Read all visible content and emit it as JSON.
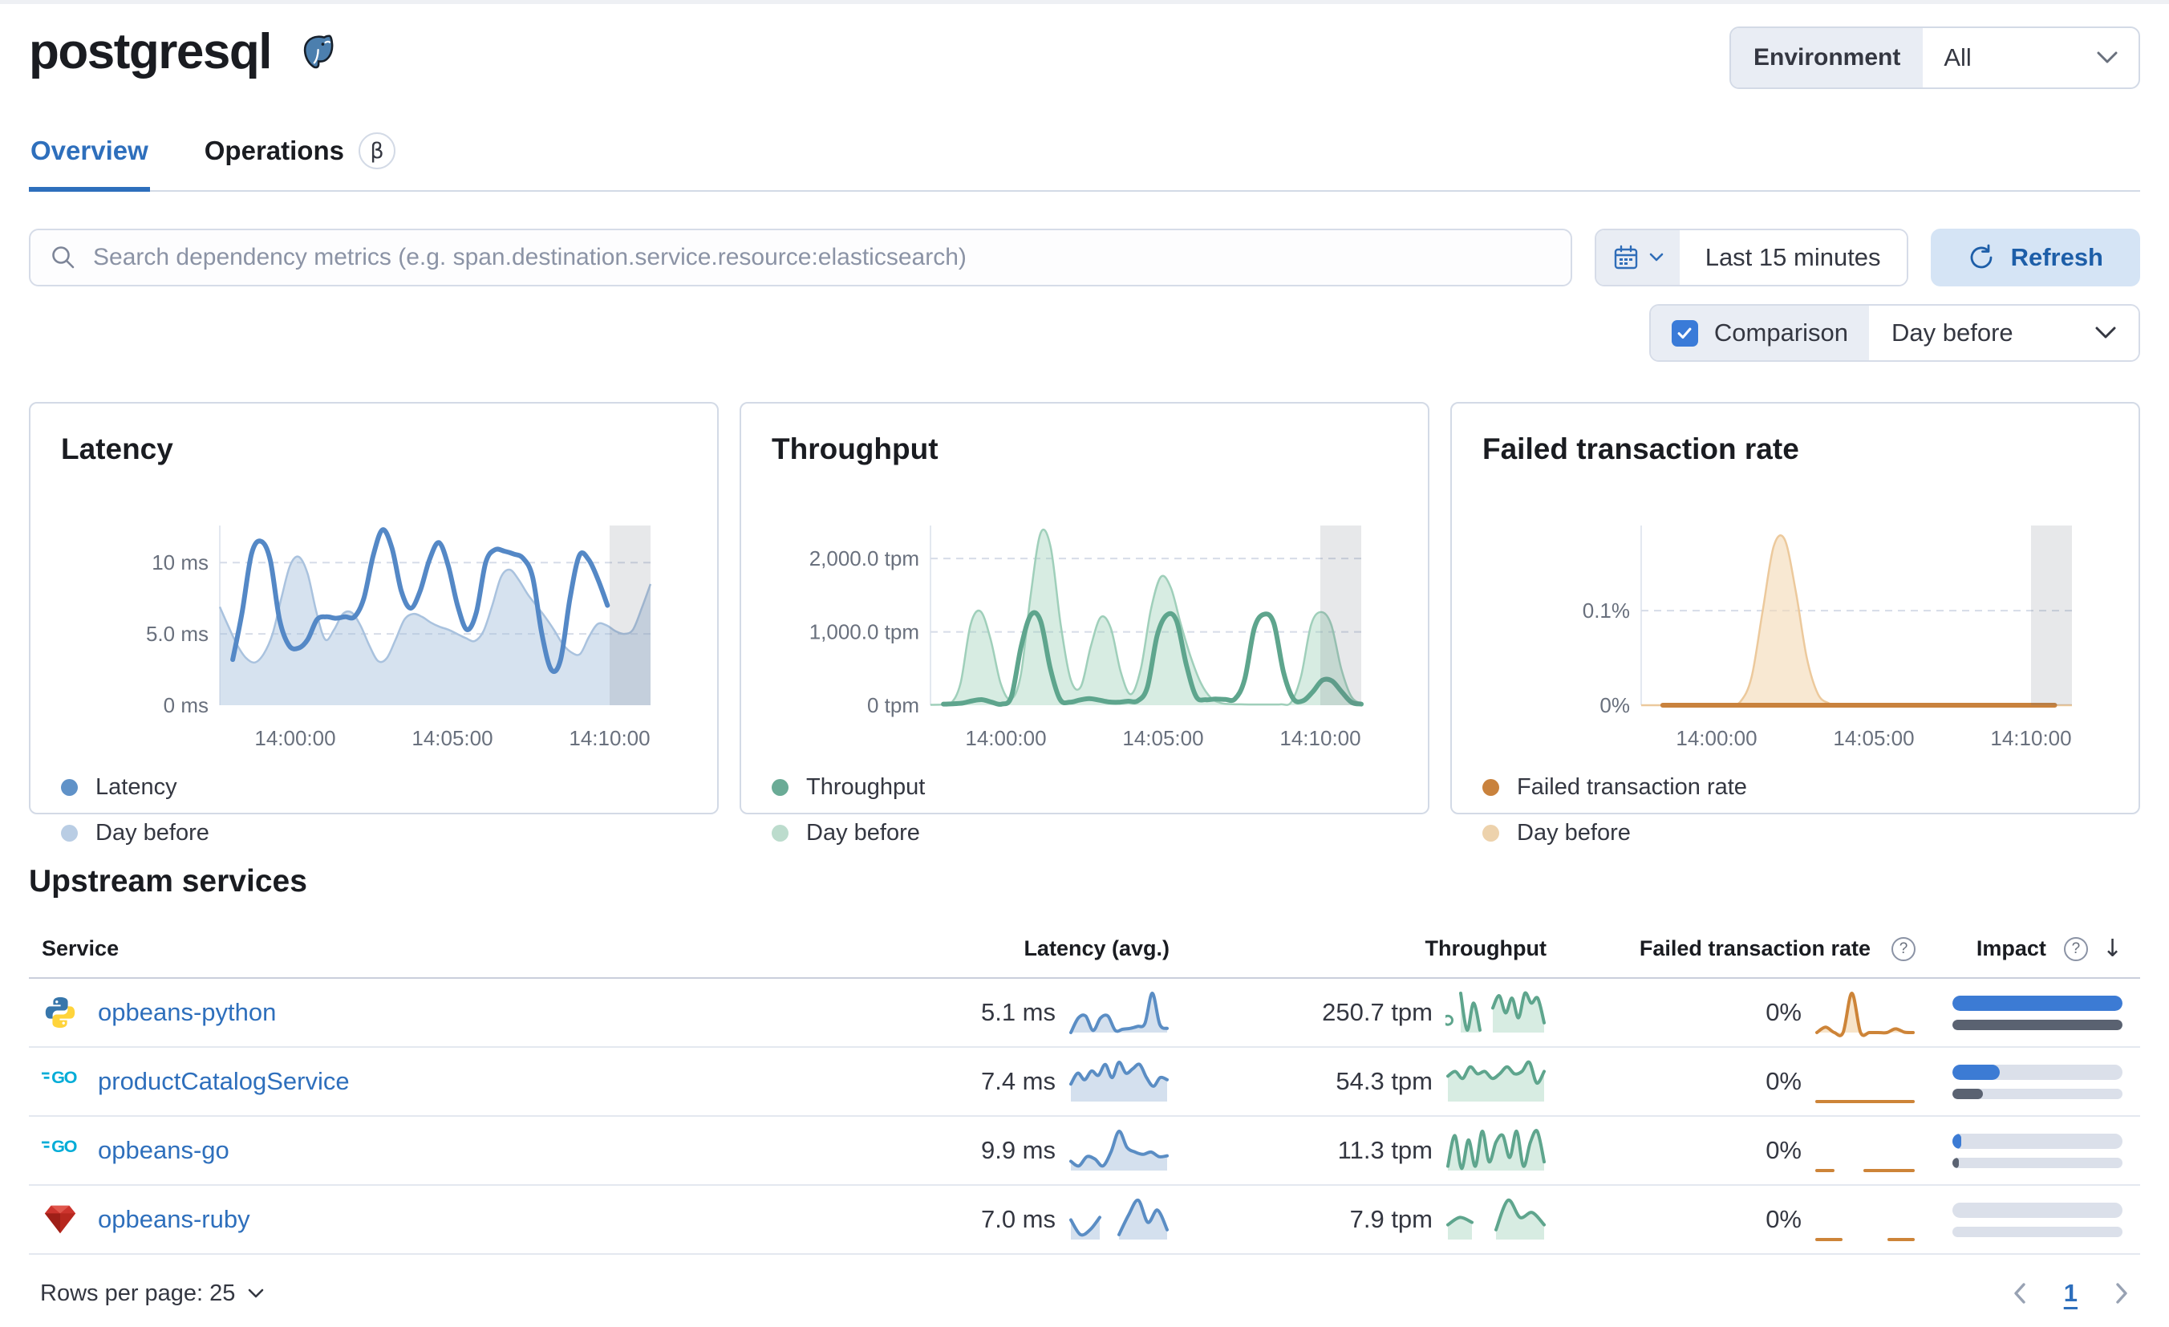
{
  "header": {
    "title": "postgresql",
    "environment_label": "Environment",
    "environment_value": "All"
  },
  "tabs": {
    "overview": "Overview",
    "operations": "Operations",
    "beta": "β"
  },
  "toolbar": {
    "search_placeholder": "Search dependency metrics (e.g. span.destination.service.resource:elasticsearch)",
    "time_range": "Last 15 minutes",
    "refresh_label": "Refresh",
    "comparison_label": "Comparison",
    "comparison_value": "Day before"
  },
  "chart_data": [
    {
      "type": "line",
      "title": "Latency",
      "ylim": [
        0,
        12.6
      ],
      "yticks": [
        {
          "value": 10,
          "label": "10 ms"
        },
        {
          "value": 5,
          "label": "5.0 ms"
        },
        {
          "value": 0,
          "label": "0 ms"
        }
      ],
      "xticks": [
        {
          "frac": 0.175,
          "label": "14:00:00"
        },
        {
          "frac": 0.54,
          "label": "14:05:00"
        },
        {
          "frac": 0.905,
          "label": "14:10:00"
        }
      ],
      "partial_band": [
        0.905,
        1.0
      ],
      "legend": [
        {
          "label": "Latency",
          "color": "#6092c8"
        },
        {
          "label": "Day before",
          "color": "#b9cde4"
        }
      ],
      "series": [
        {
          "name": "Day before",
          "kind": "area",
          "color": "#a9c2de",
          "fill": "rgba(164,190,219,0.45)",
          "x_start": 0,
          "x_end": 1,
          "values": [
            6.9,
            5.5,
            4.2,
            3.3,
            3.0,
            3.6,
            5.0,
            7.5,
            9.8,
            10.4,
            9.2,
            6.5,
            4.6,
            5.3,
            6.4,
            6.5,
            5.6,
            4.2,
            3.1,
            3.3,
            4.6,
            6.0,
            6.4,
            6.2,
            5.8,
            5.5,
            5.3,
            5.0,
            4.7,
            4.5,
            5.2,
            7.0,
            9.0,
            9.5,
            8.8,
            7.8,
            7.0,
            6.2,
            5.3,
            4.3,
            3.7,
            3.6,
            4.8,
            5.7,
            5.6,
            5.2,
            5.0,
            5.3,
            6.8,
            8.5
          ]
        },
        {
          "name": "Latency",
          "kind": "line",
          "color": "#5488c6",
          "x_start": 0.03,
          "x_end": 0.9,
          "values": [
            3.2,
            6.5,
            10.6,
            11.5,
            10.2,
            6.0,
            4.2,
            4.0,
            4.6,
            6.0,
            6.2,
            6.1,
            6.2,
            6.2,
            7.5,
            10.5,
            12.3,
            11.0,
            8.0,
            6.8,
            8.0,
            10.2,
            11.4,
            9.8,
            7.0,
            5.3,
            6.5,
            10.0,
            10.9,
            10.8,
            10.6,
            10.3,
            9.0,
            5.0,
            2.5,
            3.2,
            7.5,
            10.5,
            10.2,
            8.8,
            7.0
          ]
        }
      ]
    },
    {
      "type": "line",
      "title": "Throughput",
      "ylim": [
        0,
        2450
      ],
      "yticks": [
        {
          "value": 2000,
          "label": "2,000.0 tpm"
        },
        {
          "value": 1000,
          "label": "1,000.0 tpm"
        },
        {
          "value": 0,
          "label": "0 tpm"
        }
      ],
      "xticks": [
        {
          "frac": 0.175,
          "label": "14:00:00"
        },
        {
          "frac": 0.54,
          "label": "14:05:00"
        },
        {
          "frac": 0.905,
          "label": "14:10:00"
        }
      ],
      "partial_band": [
        0.905,
        1.0
      ],
      "legend": [
        {
          "label": "Throughput",
          "color": "#6aab96"
        },
        {
          "label": "Day before",
          "color": "#bcdccd"
        }
      ],
      "series": [
        {
          "name": "Day before",
          "kind": "area",
          "color": "#9fcfba",
          "fill": "rgba(150,205,180,0.38)",
          "x_start": 0,
          "x_end": 1,
          "values": [
            5,
            8,
            20,
            300,
            1100,
            1280,
            900,
            300,
            80,
            400,
            1500,
            2350,
            2150,
            1100,
            350,
            250,
            800,
            1200,
            1050,
            450,
            150,
            500,
            1300,
            1750,
            1600,
            1100,
            650,
            300,
            100,
            30,
            15,
            12,
            10,
            10,
            10,
            12,
            40,
            400,
            1100,
            1270,
            1100,
            500,
            120,
            20
          ]
        },
        {
          "name": "Throughput",
          "kind": "line",
          "color": "#5ea58d",
          "x_start": 0.03,
          "x_end": 1,
          "values": [
            15,
            20,
            30,
            60,
            75,
            40,
            15,
            120,
            800,
            1230,
            1150,
            500,
            80,
            40,
            70,
            90,
            70,
            45,
            40,
            55,
            60,
            250,
            950,
            1230,
            1150,
            550,
            120,
            75,
            85,
            80,
            85,
            350,
            1050,
            1240,
            1120,
            450,
            90,
            60,
            180,
            340,
            330,
            180,
            40,
            15
          ]
        }
      ]
    },
    {
      "type": "line",
      "title": "Failed transaction rate",
      "ylim": [
        0,
        0.19
      ],
      "yticks": [
        {
          "value": 0.1,
          "label": "0.1%"
        },
        {
          "value": 0,
          "label": "0%"
        }
      ],
      "xticks": [
        {
          "frac": 0.175,
          "label": "14:00:00"
        },
        {
          "frac": 0.54,
          "label": "14:05:00"
        },
        {
          "frac": 0.905,
          "label": "14:10:00"
        }
      ],
      "partial_band": [
        0.905,
        1.0
      ],
      "legend": [
        {
          "label": "Failed transaction rate",
          "color": "#c9823d"
        },
        {
          "label": "Day before",
          "color": "#edd2ac"
        }
      ],
      "series": [
        {
          "name": "Day before",
          "kind": "area",
          "color": "#ecc99c",
          "fill": "rgba(243,216,180,0.6)",
          "x_start": 0,
          "x_end": 1,
          "values": [
            0,
            0,
            0,
            0,
            0,
            0,
            0,
            0,
            0,
            0.004,
            0.03,
            0.1,
            0.168,
            0.175,
            0.12,
            0.05,
            0.012,
            0.002,
            0,
            0,
            0,
            0,
            0,
            0,
            0,
            0,
            0,
            0,
            0,
            0,
            0,
            0,
            0,
            0,
            0,
            0,
            0,
            0,
            0,
            0
          ]
        },
        {
          "name": "Failed transaction rate",
          "kind": "line",
          "color": "#c9823d",
          "x_start": 0.05,
          "x_end": 0.96,
          "values": [
            0,
            0,
            0,
            0,
            0,
            0,
            0,
            0,
            0,
            0,
            0,
            0,
            0
          ]
        }
      ]
    }
  ],
  "table": {
    "section_title": "Upstream services",
    "columns": {
      "service": "Service",
      "latency": "Latency (avg.)",
      "throughput": "Throughput",
      "failed": "Failed transaction rate",
      "impact": "Impact"
    },
    "rows": [
      {
        "name": "opbeans-python",
        "icon": "python-icon",
        "latency": "5.1 ms",
        "throughput": "250.7 tpm",
        "failed": "0%",
        "impact": {
          "current": 100,
          "previous": 100
        },
        "sparks": {
          "latency": {
            "color": "#5a8dc4",
            "fill": "rgba(160,187,217,0.45)",
            "values": [
              0,
              3.5,
              4,
              0.5,
              3.5,
              4,
              0.5,
              0.8,
              1,
              1.5,
              2.2,
              9.5,
              2,
              1
            ]
          },
          "throughput": {
            "color": "#5ea58d",
            "fill": "rgba(150,205,180,0.38)",
            "marker": [
              0,
              2.5
            ],
            "values": [
              null,
              null,
              8,
              0.5,
              6,
              0.5,
              null,
              5,
              7.5,
              4,
              7,
              3,
              8,
              6,
              7,
              2
            ]
          },
          "failed": {
            "color": "#cd8438",
            "fill": "rgba(243,216,180,0.7)",
            "values": [
              0,
              1.3,
              0,
              0,
              9.5,
              0,
              0,
              0,
              0,
              0.9,
              0.1,
              0
            ]
          }
        }
      },
      {
        "name": "productCatalogService",
        "icon": "go-icon",
        "latency": "7.4 ms",
        "throughput": "54.3 tpm",
        "failed": "0%",
        "impact": {
          "current": 28,
          "previous": 18
        },
        "sparks": {
          "latency": {
            "color": "#5a8dc4",
            "fill": "rgba(160,187,217,0.45)",
            "values": [
              4,
              6.5,
              5,
              7,
              6,
              8.5,
              5.5,
              9,
              6.5,
              7.5,
              8.5,
              5.5,
              3.5,
              5.5,
              5
            ]
          },
          "throughput": {
            "color": "#5ea58d",
            "fill": "rgba(150,205,180,0.38)",
            "values": [
              5.5,
              6.5,
              5,
              7.5,
              6,
              6.5,
              5,
              6,
              7.5,
              6,
              6.5,
              8.5,
              4,
              6.5
            ]
          },
          "failed": {
            "color": "#cd8438",
            "fill": "none",
            "values": [
              0,
              0,
              0,
              0,
              0,
              0,
              0,
              0
            ]
          }
        }
      },
      {
        "name": "opbeans-go",
        "icon": "go-icon",
        "latency": "9.9 ms",
        "throughput": "11.3 tpm",
        "failed": "0%",
        "impact": {
          "current": 5,
          "previous": 4
        },
        "sparks": {
          "latency": {
            "color": "#5a8dc4",
            "fill": "rgba(160,187,217,0.45)",
            "values": [
              2,
              1,
              3,
              2.5,
              1,
              4,
              8.5,
              5,
              4,
              3.5,
              4,
              3,
              3.2
            ]
          },
          "throughput": {
            "color": "#5ea58d",
            "fill": "rgba(150,205,180,0.38)",
            "values": [
              1,
              8,
              0.5,
              7,
              1,
              9,
              2,
              6.5,
              8,
              3,
              9,
              1,
              6.5,
              9,
              2
            ]
          },
          "failed": {
            "color": "#cd8438",
            "fill": "none",
            "values": [
              0,
              0,
              null,
              0,
              0,
              0,
              0
            ]
          }
        }
      },
      {
        "name": "opbeans-ruby",
        "icon": "ruby-icon",
        "latency": "7.0 ms",
        "throughput": "7.9 tpm",
        "failed": "0%",
        "impact": {
          "current": 0,
          "previous": 0
        },
        "sparks": {
          "latency": {
            "color": "#5a8dc4",
            "fill": "rgba(160,187,217,0.45)",
            "values": [
              4,
              1,
              2,
              4.5,
              null,
              1,
              5,
              8,
              3.5,
              6,
              2
            ]
          },
          "throughput": {
            "color": "#5ea58d",
            "fill": "rgba(150,205,180,0.38)",
            "values": [
              3,
              4.5,
              3.5,
              null,
              2,
              8,
              4.5,
              5.5,
              3
            ]
          },
          "failed": {
            "color": "#cd8438",
            "fill": "none",
            "values": [
              0,
              0,
              null,
              0,
              0
            ]
          }
        }
      }
    ],
    "footer": {
      "rows_per_page": "Rows per page: 25",
      "page": "1"
    }
  }
}
